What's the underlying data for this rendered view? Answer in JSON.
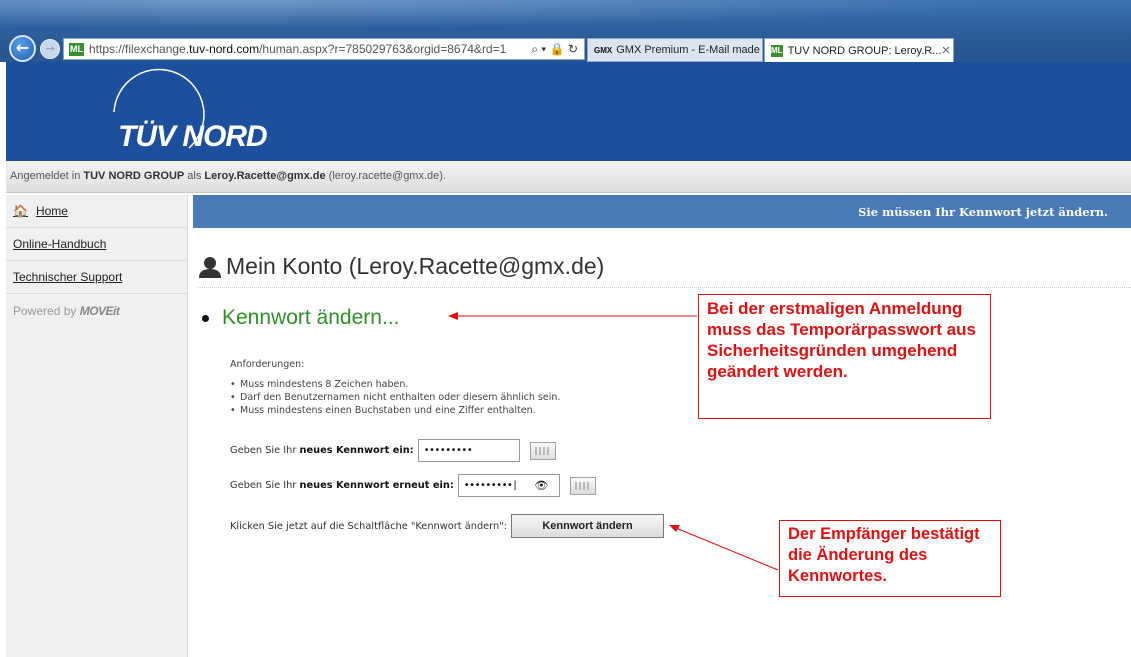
{
  "browser": {
    "url_scheme": "https://filexchange.",
    "url_domain": "tuv-nord.com",
    "url_path": "/human.aspx?r=785029763&orgid=8674&rd=1",
    "url_icons": "⌕ ▾ 🔒 ↻",
    "favicon_text": "ML",
    "tabs": [
      {
        "label": "GMX Premium - E-Mail made i...",
        "icon": "GMX"
      },
      {
        "label": "TUV NORD GROUP: Leroy.R...",
        "icon": "ML",
        "close": "✕"
      }
    ]
  },
  "header": {
    "logo": "TÜV NORD",
    "login_prefix": "Angemeldet in ",
    "org": "TUV NORD GROUP",
    "login_middle": " als ",
    "user": "Leroy.Racette@gmx.de",
    "login_suffix": " (leroy.racette@gmx.de)."
  },
  "sidebar": {
    "items": [
      {
        "label": "Home"
      },
      {
        "label": "Online-Handbuch"
      },
      {
        "label": "Technischer Support"
      }
    ],
    "powered_prefix": "Powered by ",
    "powered_brand": "MOVEit"
  },
  "main": {
    "notice": "Sie müssen Ihr Kennwort jetzt ändern.",
    "title": "Mein Konto (Leroy.Racette@gmx.de)",
    "section": "Kennwort ändern...",
    "requirements_title": "Anforderungen:",
    "requirements": [
      "Muss mindestens 8 Zeichen haben.",
      "Darf den Benutzernamen nicht enthalten oder diesem ähnlich sein.",
      "Muss mindestens einen Buchstaben und eine Ziffer enthalten."
    ],
    "new_pw_prefix": "Geben Sie Ihr ",
    "new_pw_bold": "neues Kennwort ein:",
    "new_pw_value": "•••••••••",
    "confirm_pw_prefix": "Geben Sie Ihr ",
    "confirm_pw_bold": "neues Kennwort erneut ein:",
    "confirm_pw_value": "•••••••••",
    "submit_instruction": "Klicken Sie jetzt auf die Schaltfläche \"Kennwort ändern\":",
    "submit_label": "Kennwort ändern"
  },
  "annotations": {
    "callout1": "Bei der erstmaligen Anmeldung muss das Temporärpasswort aus Sicherheitsgründen umgehend geändert werden.",
    "callout2": "Der Empfänger bestätigt die Änderung des Kennwortes.",
    "color": "#e01010"
  },
  "colors": {
    "brand_blue": "#1c4f9c",
    "notice_blue": "#4b7ab8",
    "section_green": "#2e9127"
  }
}
